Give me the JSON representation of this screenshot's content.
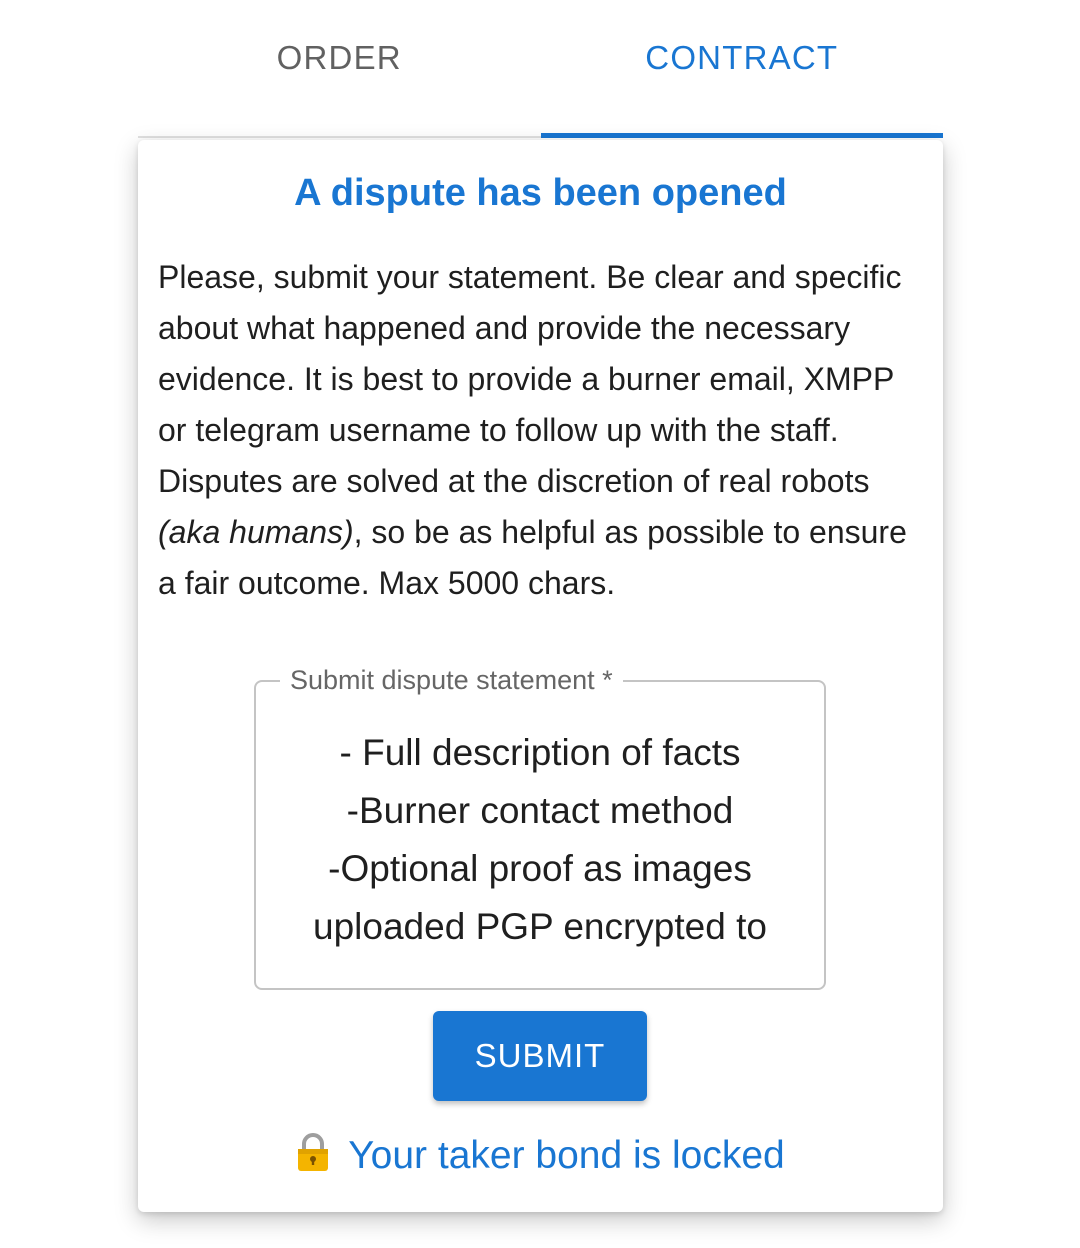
{
  "tabs": [
    {
      "label": "ORDER",
      "active": false
    },
    {
      "label": "CONTRACT",
      "active": true
    }
  ],
  "card": {
    "title": "A dispute has been opened",
    "description_part1": "Please, submit your statement. Be clear and specific about what happened and provide the necessary evidence. It is best to provide a burner email, XMPP or telegram username to follow up with the staff. Disputes are solved at the discretion of real robots ",
    "description_italic": "(aka humans)",
    "description_part2": ", so be as helpful as possible to ensure a fair outcome. Max 5000 chars.",
    "field": {
      "label": "Submit dispute statement *",
      "lines": [
        "- Full description of facts",
        "-Burner contact method",
        "-Optional proof as images",
        "uploaded PGP encrypted to"
      ]
    },
    "submit_label": "SUBMIT",
    "bond_status": "Your taker bond is locked",
    "bond_icon": "lock-icon"
  },
  "colors": {
    "accent": "#1976d2",
    "lock": "#f4b400"
  }
}
